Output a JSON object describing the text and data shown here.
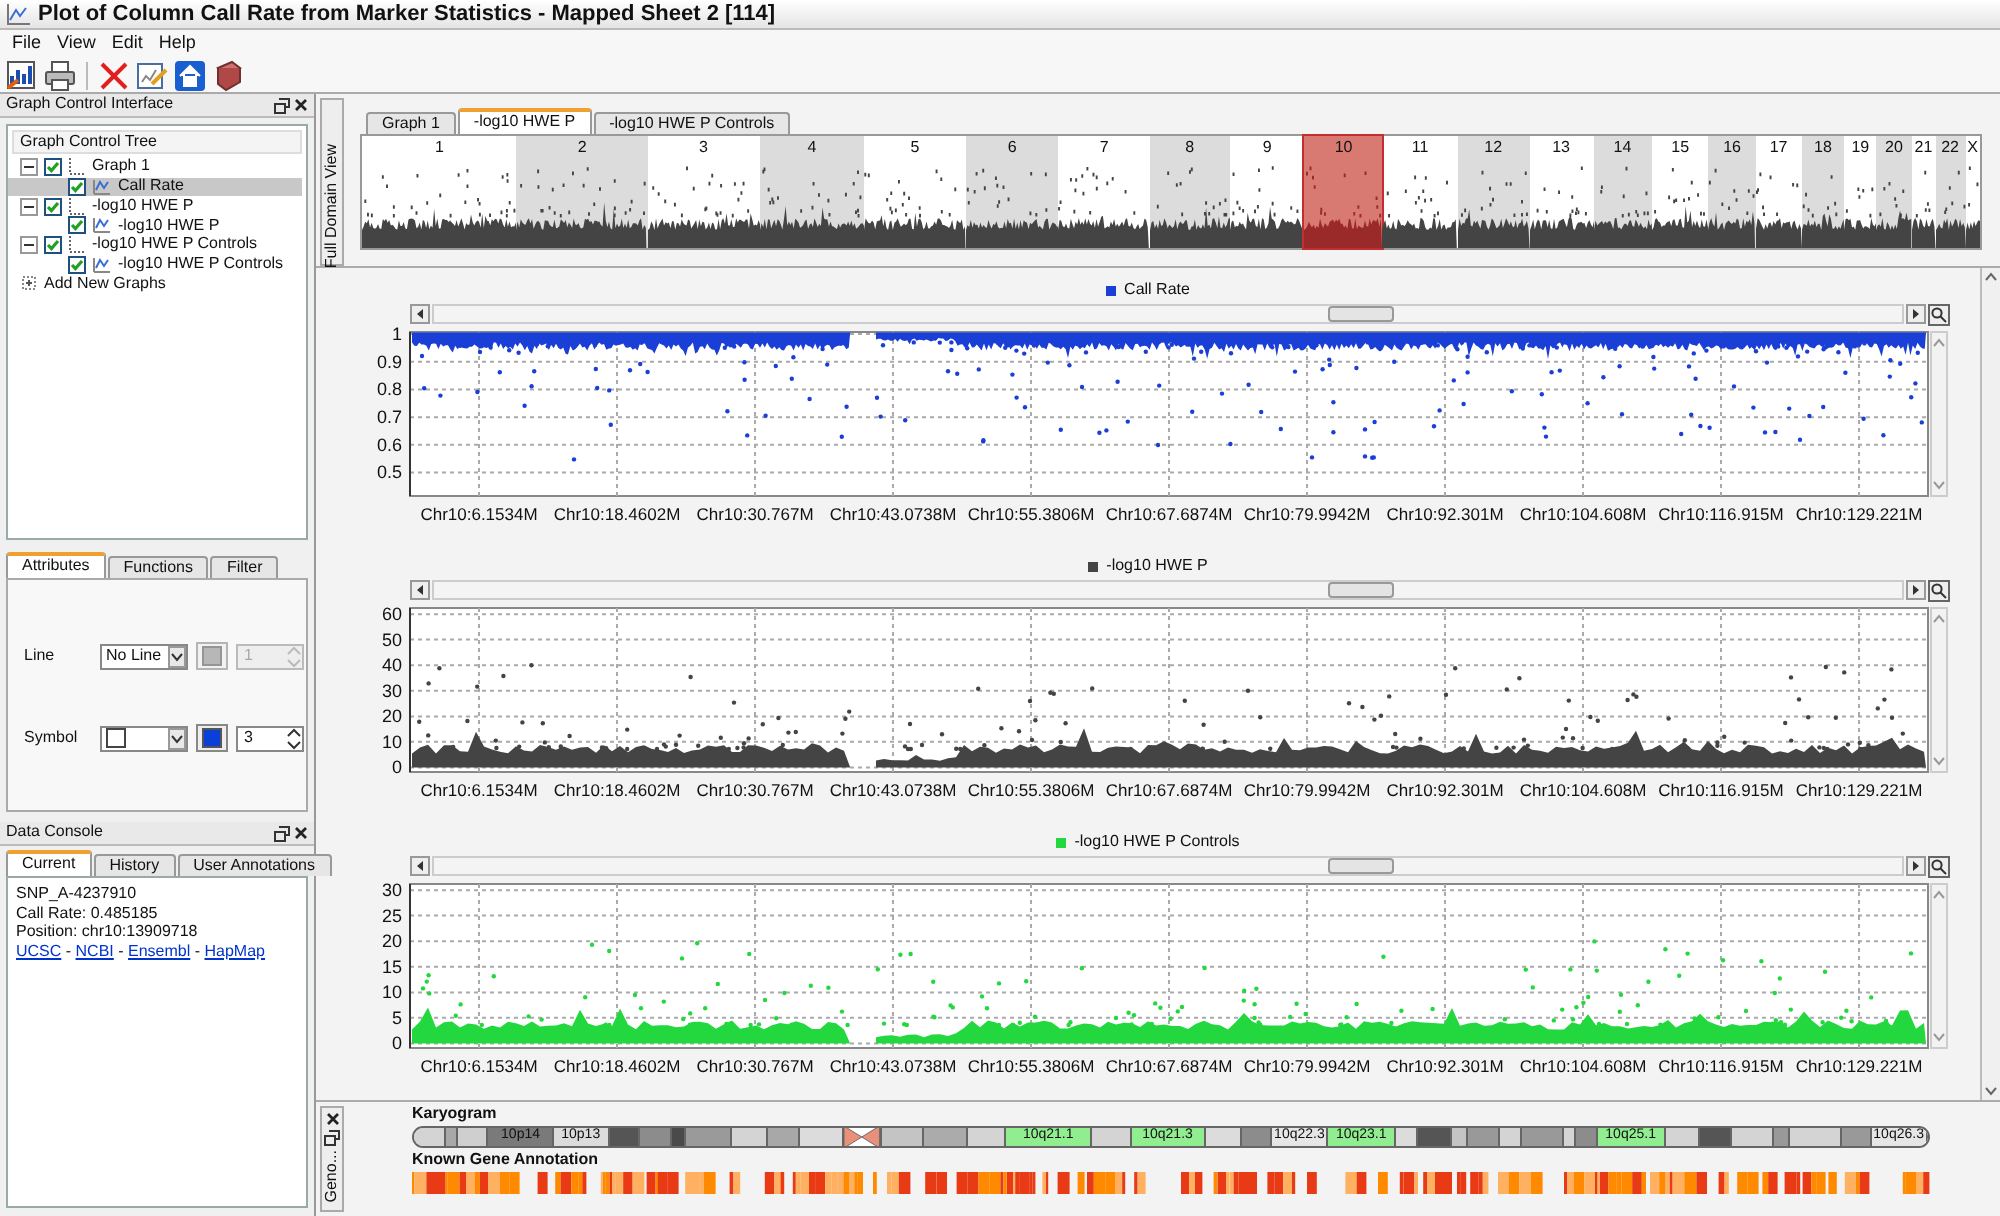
{
  "window": {
    "title": "Plot of Column Call Rate from Marker Statistics - Mapped Sheet 2 [114]"
  },
  "menu": [
    "File",
    "View",
    "Edit",
    "Help"
  ],
  "graph_control": {
    "title": "Graph Control Interface",
    "tree_title": "Graph Control Tree",
    "tree": [
      {
        "label": "Graph 1",
        "checked": true,
        "expanded": true,
        "children": [
          {
            "label": "Call Rate",
            "checked": true,
            "selected": true
          }
        ]
      },
      {
        "label": "-log10 HWE P",
        "checked": true,
        "expanded": true,
        "children": [
          {
            "label": "-log10 HWE P",
            "checked": true,
            "selected": false
          }
        ]
      },
      {
        "label": "-log10 HWE P Controls",
        "checked": true,
        "expanded": true,
        "children": [
          {
            "label": "-log10 HWE P Controls",
            "checked": true,
            "selected": false
          }
        ]
      }
    ],
    "add_label": "Add New Graphs"
  },
  "attributes": {
    "tabs": [
      {
        "label": "Attributes",
        "selected": true
      },
      {
        "label": "Functions",
        "selected": false
      },
      {
        "label": "Filter",
        "selected": false
      }
    ],
    "rows": [
      {
        "label": "Line",
        "kind": "text",
        "value": "No Line",
        "color": "#8c8c8c",
        "size": "1",
        "disabled": true
      },
      {
        "label": "Symbol",
        "kind": "symbol",
        "color": "#0a3fd8",
        "size": "3",
        "disabled": false
      }
    ]
  },
  "data_console": {
    "title": "Data Console",
    "tabs": [
      {
        "label": "Current",
        "selected": true
      },
      {
        "label": "History",
        "selected": false
      },
      {
        "label": "User Annotations",
        "selected": false
      }
    ],
    "lines": [
      "SNP_A-4237910",
      "Call Rate: 0.485185",
      "Position: chr10:13909718"
    ],
    "links": [
      "UCSC",
      "NCBI",
      "Ensembl",
      "HapMap"
    ],
    "link_separator": "-"
  },
  "full_view": {
    "side_label": "Full Domain View",
    "tabs": [
      {
        "label": "Graph 1",
        "selected": false
      },
      {
        "label": "-log10 HWE P",
        "selected": true
      },
      {
        "label": "-log10 HWE P Controls",
        "selected": false
      }
    ],
    "chromosomes": [
      {
        "label": "1",
        "selected": false
      },
      {
        "label": "2",
        "selected": false
      },
      {
        "label": "3",
        "selected": false
      },
      {
        "label": "4",
        "selected": false
      },
      {
        "label": "5",
        "selected": false
      },
      {
        "label": "6",
        "selected": false
      },
      {
        "label": "7",
        "selected": false
      },
      {
        "label": "8",
        "selected": false
      },
      {
        "label": "9",
        "selected": false
      },
      {
        "label": "10",
        "selected": true
      },
      {
        "label": "11",
        "selected": false
      },
      {
        "label": "12",
        "selected": false
      },
      {
        "label": "13",
        "selected": false
      },
      {
        "label": "14",
        "selected": false
      },
      {
        "label": "15",
        "selected": false
      },
      {
        "label": "16",
        "selected": false
      },
      {
        "label": "17",
        "selected": false
      },
      {
        "label": "18",
        "selected": false
      },
      {
        "label": "19",
        "selected": false
      },
      {
        "label": "20",
        "selected": false
      },
      {
        "label": "21",
        "selected": false
      },
      {
        "label": "22",
        "selected": false
      },
      {
        "label": "X",
        "selected": false
      }
    ]
  },
  "plots": [
    {
      "title": "Call Rate",
      "color": "#1a3fd6",
      "yticks": [
        "1",
        "0.9",
        "0.8",
        "0.7",
        "0.6",
        "0.5"
      ],
      "xticks": [
        "Chr10:6.1534M",
        "Chr10:18.4602M",
        "Chr10:30.767M",
        "Chr10:43.0738M",
        "Chr10:55.3806M",
        "Chr10:67.6874M",
        "Chr10:79.9942M",
        "Chr10:92.301M",
        "Chr10:104.608M",
        "Chr10:116.915M",
        "Chr10:129.221M"
      ]
    },
    {
      "title": "-log10 HWE P",
      "color": "#444444",
      "yticks": [
        "60",
        "50",
        "40",
        "30",
        "20",
        "10",
        "0"
      ],
      "xticks": [
        "Chr10:6.1534M",
        "Chr10:18.4602M",
        "Chr10:30.767M",
        "Chr10:43.0738M",
        "Chr10:55.3806M",
        "Chr10:67.6874M",
        "Chr10:79.9942M",
        "Chr10:92.301M",
        "Chr10:104.608M",
        "Chr10:116.915M",
        "Chr10:129.221M"
      ]
    },
    {
      "title": "-log10 HWE P Controls",
      "color": "#22d83e",
      "yticks": [
        "30",
        "25",
        "20",
        "15",
        "10",
        "5",
        "0"
      ],
      "xticks": [
        "Chr10:6.1534M",
        "Chr10:18.4602M",
        "Chr10:30.767M",
        "Chr10:43.0738M",
        "Chr10:55.3806M",
        "Chr10:67.6874M",
        "Chr10:79.9942M",
        "Chr10:92.301M",
        "Chr10:104.608M",
        "Chr10:116.915M",
        "Chr10:129.221M"
      ]
    }
  ],
  "genome": {
    "side_label": "Geno...",
    "karyogram_title": "Karyogram",
    "annotation_title": "Known Gene Annotation",
    "bands": [
      {
        "kind": "band",
        "color": "#d4d4d4"
      },
      {
        "kind": "band",
        "color": "#a8a8a8"
      },
      {
        "kind": "band",
        "color": "#cfcfcf"
      },
      {
        "kind": "band",
        "color": "#7a7a7a",
        "label": "10p14"
      },
      {
        "kind": "band",
        "color": "#dcdcdc",
        "label": "10p13"
      },
      {
        "kind": "band",
        "color": "#555555"
      },
      {
        "kind": "band",
        "color": "#8c8c8c"
      },
      {
        "kind": "band",
        "color": "#4a4a4a"
      },
      {
        "kind": "band",
        "color": "#9a9a9a"
      },
      {
        "kind": "band",
        "color": "#d4d4d4"
      },
      {
        "kind": "band",
        "color": "#a8a8a8"
      },
      {
        "kind": "band",
        "color": "#dcdcdc"
      },
      {
        "kind": "centromere",
        "color": "#e8907a"
      },
      {
        "kind": "band",
        "color": "#c4c4c4"
      },
      {
        "kind": "band",
        "color": "#ababab"
      },
      {
        "kind": "band",
        "color": "#d4d4d4"
      },
      {
        "kind": "band",
        "color": "#90ee90",
        "label": "10q21.1"
      },
      {
        "kind": "band",
        "color": "#d4d4d4"
      },
      {
        "kind": "band",
        "color": "#90ee90",
        "label": "10q21.3"
      },
      {
        "kind": "band",
        "color": "#dcdcdc"
      },
      {
        "kind": "band",
        "color": "#8c8c8c"
      },
      {
        "kind": "band",
        "color": "#e6e6e6",
        "label": "10q22.3"
      },
      {
        "kind": "band",
        "color": "#90ee90",
        "label": "10q23.1"
      },
      {
        "kind": "band",
        "color": "#dcdcdc"
      },
      {
        "kind": "band",
        "color": "#555555"
      },
      {
        "kind": "band",
        "color": "#c4c4c4"
      },
      {
        "kind": "band",
        "color": "#999999"
      },
      {
        "kind": "band",
        "color": "#d4d4d4"
      },
      {
        "kind": "band",
        "color": "#999999"
      },
      {
        "kind": "band",
        "color": "#d4d4d4"
      },
      {
        "kind": "band",
        "color": "#8c8c8c"
      },
      {
        "kind": "band",
        "color": "#90ee90",
        "label": "10q25.1"
      },
      {
        "kind": "band",
        "color": "#d4d4d4"
      },
      {
        "kind": "band",
        "color": "#555555"
      },
      {
        "kind": "band",
        "color": "#d4d4d4"
      },
      {
        "kind": "band",
        "color": "#999999"
      },
      {
        "kind": "band",
        "color": "#d4d4d4"
      },
      {
        "kind": "band",
        "color": "#999999"
      },
      {
        "kind": "band",
        "color": "#e6e6e6",
        "label": "10q26.3"
      }
    ]
  }
}
